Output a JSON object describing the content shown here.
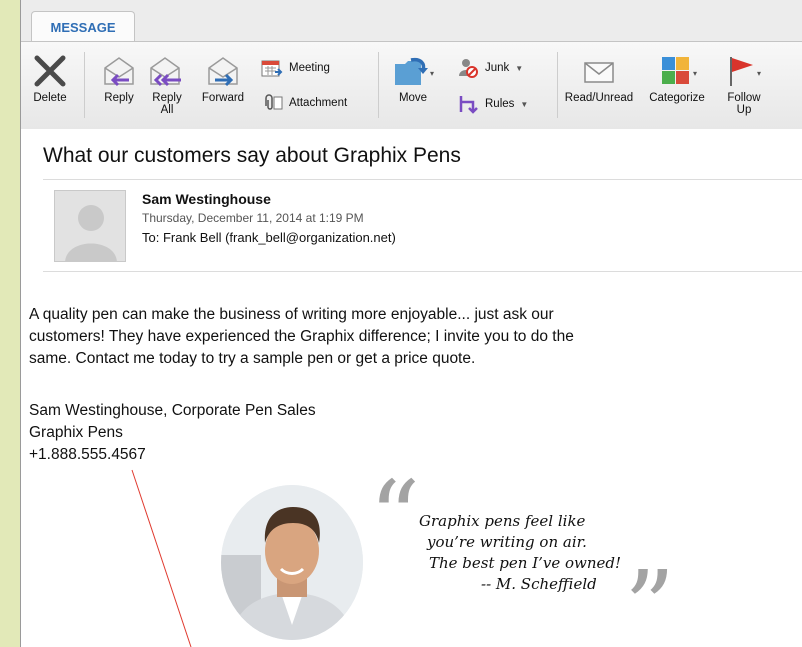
{
  "ribbon": {
    "active_tab": "MESSAGE",
    "buttons": {
      "delete": "Delete",
      "reply": "Reply",
      "reply_all_1": "Reply",
      "reply_all_2": "All",
      "forward": "Forward",
      "meeting": "Meeting",
      "attachment": "Attachment",
      "move": "Move",
      "junk": "Junk",
      "rules": "Rules",
      "read_unread": "Read/Unread",
      "categorize": "Categorize",
      "follow_up_1": "Follow",
      "follow_up_2": "Up"
    }
  },
  "message": {
    "subject": "What our customers say about Graphix Pens",
    "sender": "Sam Westinghouse",
    "date": "Thursday, December 11, 2014 at 1:19 PM",
    "to": "To: Frank Bell (frank_bell@organization.net)",
    "body_lines": [
      "A quality pen can make the business of writing more enjoyable... just ask our",
      "customers! They have experienced the Graphix difference; I invite you to do the",
      "same. Contact me today to try a sample pen or get a price quote."
    ],
    "signature": {
      "line1": "Sam Westinghouse, Corporate Pen Sales",
      "line2": "Graphix Pens",
      "line3": "+1.888.555.4567"
    },
    "testimonial": {
      "lines": [
        "Graphix pens feel like",
        "you’re writing on air.",
        "The best pen I’ve owned!",
        "-- M. Scheffield"
      ]
    }
  },
  "colors": {
    "background": "#e2e9b8",
    "tab_text": "#2f6eb5",
    "callout_line": "#e03a2f"
  }
}
